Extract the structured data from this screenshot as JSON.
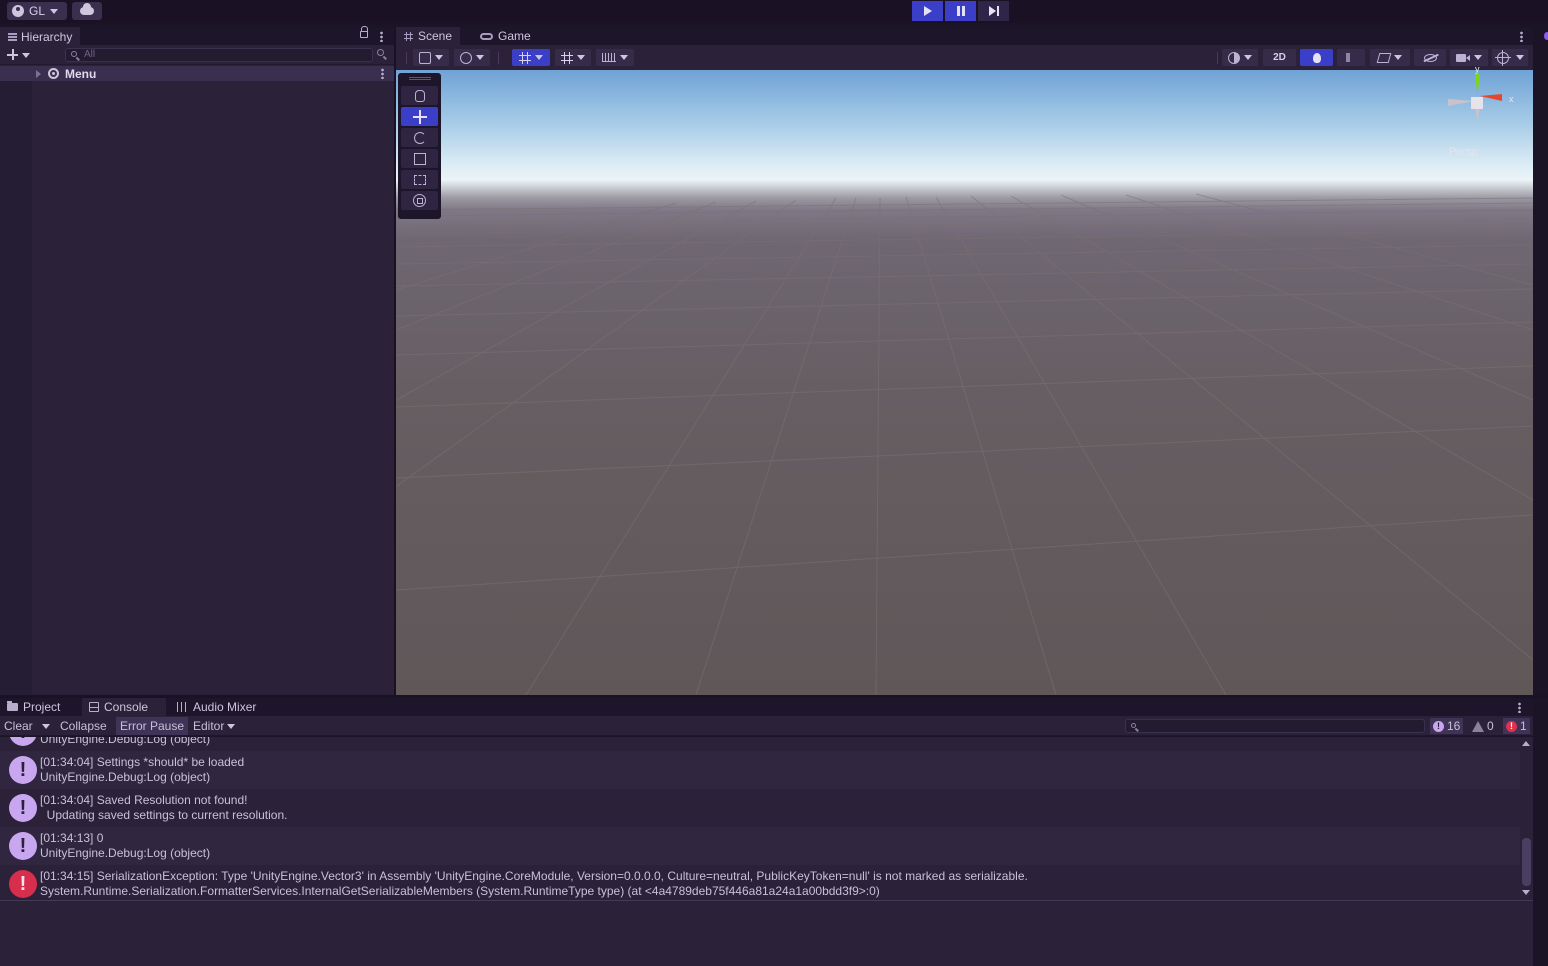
{
  "topbar": {
    "account_label": "GL",
    "icons": [
      "account-icon",
      "chevron-down-icon",
      "cloud-icon",
      "play-icon",
      "pause-icon",
      "step-icon"
    ]
  },
  "hierarchy": {
    "tab_label": "Hierarchy",
    "search_placeholder": "All",
    "items": [
      {
        "label": "Menu"
      }
    ]
  },
  "scene_view": {
    "tabs": [
      {
        "label": "Scene",
        "active": true
      },
      {
        "label": "Game",
        "active": false
      }
    ],
    "toolbar": {
      "mode_2d_label": "2D"
    },
    "gizmo": {
      "y_label": "y",
      "x_label": "x",
      "projection_label": "Persp"
    }
  },
  "bottom_panel": {
    "tabs": [
      {
        "label": "Project",
        "active": false
      },
      {
        "label": "Console",
        "active": true
      },
      {
        "label": "Audio Mixer",
        "active": false
      }
    ],
    "toolbar": {
      "clear_label": "Clear",
      "collapse_label": "Collapse",
      "error_pause_label": "Error Pause",
      "editor_label": "Editor"
    },
    "counts": {
      "info": "16",
      "warnings": "0",
      "errors": "1"
    },
    "log_entries": [
      {
        "line1": "",
        "line2": "UnityEngine.Debug:Log (object)",
        "type": "info",
        "partial": true
      },
      {
        "line1": "[01:34:04] Settings *should* be loaded",
        "line2": "UnityEngine.Debug:Log (object)",
        "type": "info"
      },
      {
        "line1": "[01:34:04] Saved Resolution not found!",
        "line2": "  Updating saved settings to current resolution.",
        "type": "info"
      },
      {
        "line1": "[01:34:13] 0",
        "line2": "UnityEngine.Debug:Log (object)",
        "type": "info"
      },
      {
        "line1": "[01:34:15] SerializationException: Type 'UnityEngine.Vector3' in Assembly 'UnityEngine.CoreModule, Version=0.0.0.0, Culture=neutral, PublicKeyToken=null' is not marked as serializable.",
        "line2": "System.Runtime.Serialization.FormatterServices.InternalGetSerializableMembers (System.RuntimeType type) (at <4a4789deb75f446a81a24a1a00bdd3f9>:0)",
        "type": "error"
      }
    ]
  },
  "colors": {
    "accent": "#3b3fc7",
    "panel": "#2b2239",
    "info_icon": "#c9a7f0",
    "error_icon": "#d62e4c",
    "gizmo_y": "#7ed321",
    "gizmo_x": "#e8452c"
  }
}
